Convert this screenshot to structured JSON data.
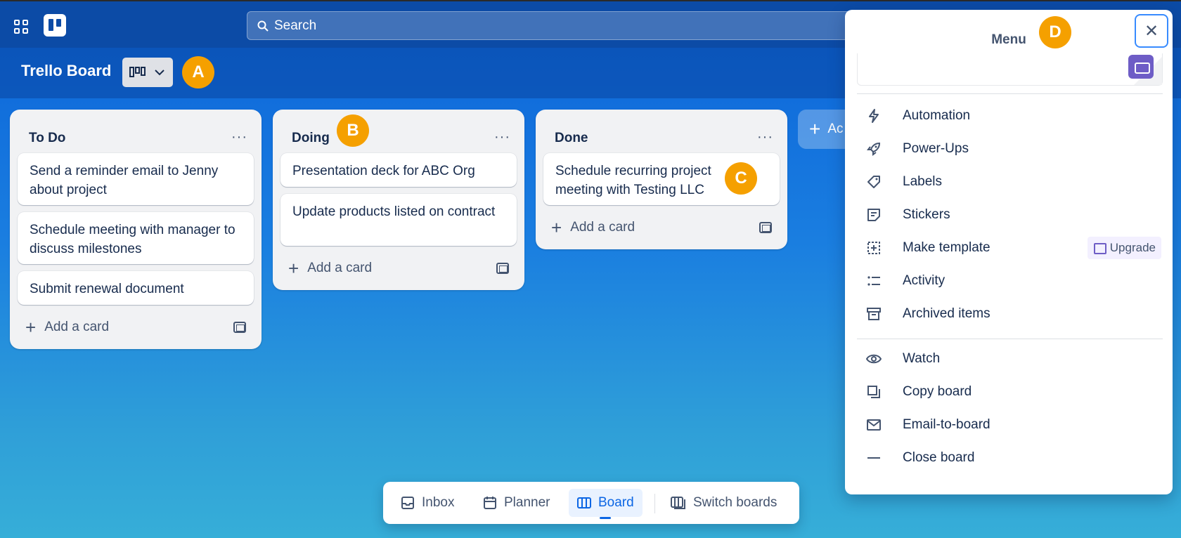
{
  "search": {
    "placeholder": "Search"
  },
  "board": {
    "title": "Trello Board"
  },
  "badges": {
    "a": "A",
    "b": "B",
    "c": "C",
    "d": "D"
  },
  "lists": [
    {
      "title": "To Do",
      "more": "···",
      "cards": [
        "Send a reminder email to Jenny about project",
        "Schedule meeting with manager to discuss milestones",
        "Submit renewal document"
      ],
      "add_label": "Add a card"
    },
    {
      "title": "Doing",
      "more": "···",
      "cards": [
        "Presentation deck for ABC Org",
        "Update products listed on contract"
      ],
      "add_label": "Add a card"
    },
    {
      "title": "Done",
      "more": "···",
      "cards": [
        "Schedule recurring project meeting with Testing LLC"
      ],
      "add_label": "Add a card"
    }
  ],
  "add_list": {
    "label": "Ac"
  },
  "bottom_nav": {
    "inbox": "Inbox",
    "planner": "Planner",
    "board": "Board",
    "switch": "Switch boards"
  },
  "menu": {
    "title": "Menu",
    "close": "✕",
    "items": [
      "Automation",
      "Power-Ups",
      "Labels",
      "Stickers",
      "Make template",
      "Activity",
      "Archived items",
      "Watch",
      "Copy board",
      "Email-to-board",
      "Close board"
    ],
    "upgrade": "Upgrade"
  },
  "colors": {
    "accent": "#0c66e4",
    "badge": "#f5a000",
    "upgrade": "#6e5dc6"
  }
}
